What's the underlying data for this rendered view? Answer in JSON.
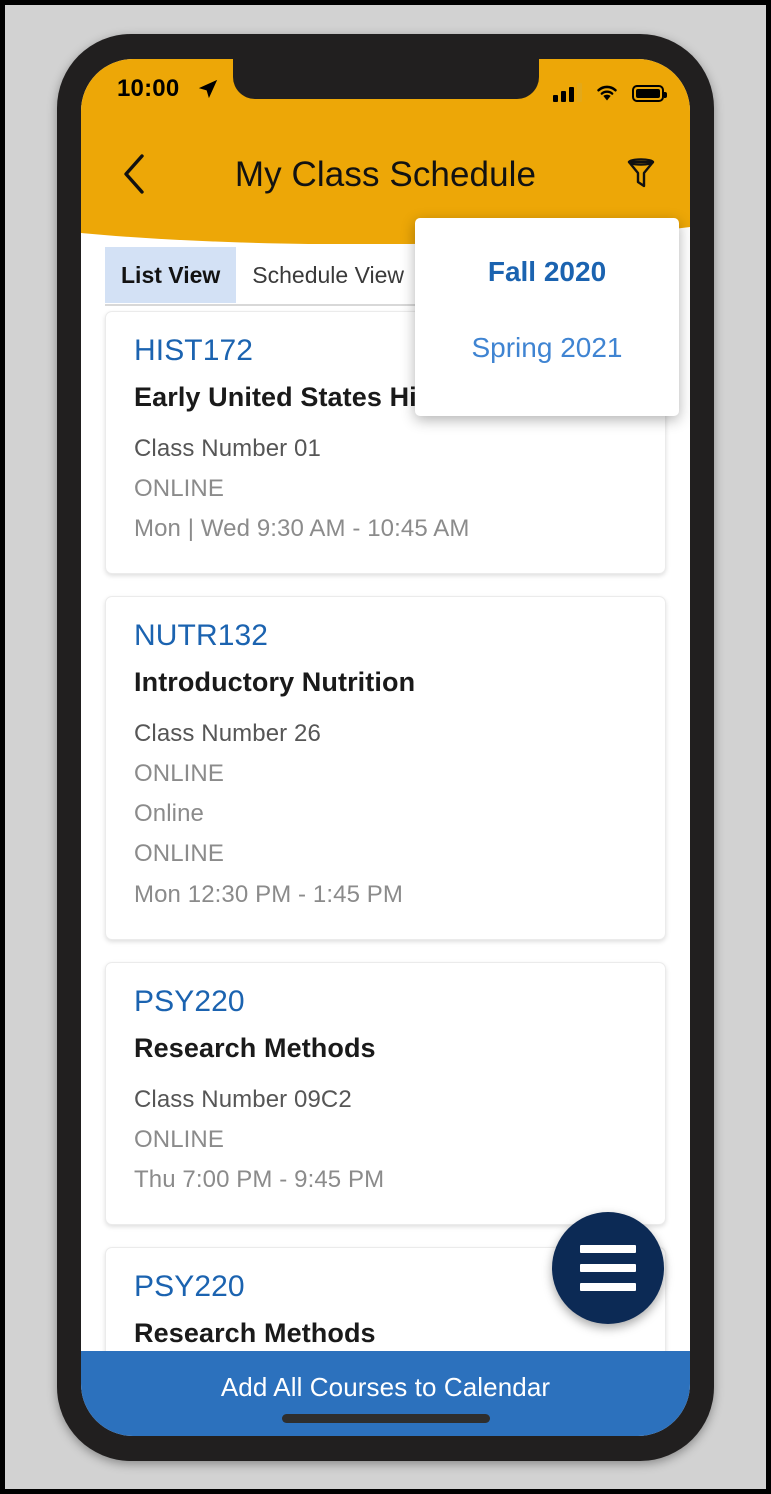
{
  "status_bar": {
    "time": "10:00",
    "location_icon": "location-arrow-icon",
    "signal_icon": "cellular-signal-icon",
    "wifi_icon": "wifi-icon",
    "battery_icon": "battery-full-icon"
  },
  "header": {
    "title": "My Class Schedule",
    "back_icon": "chevron-left-icon",
    "filter_icon": "filter-funnel-icon",
    "background_color": "#eda707"
  },
  "tabs": [
    {
      "label": "List View",
      "active": true
    },
    {
      "label": "Schedule View",
      "active": false
    }
  ],
  "term_menu": {
    "open": true,
    "items": [
      {
        "label": "Fall 2020",
        "selected": true
      },
      {
        "label": "Spring 2021",
        "selected": false
      }
    ]
  },
  "courses": [
    {
      "code": "HIST172",
      "title": "Early United States History",
      "details": [
        {
          "text": "Class Number 01",
          "muted": false
        },
        {
          "text": "ONLINE",
          "muted": true
        },
        {
          "text": "Mon | Wed 9:30 AM - 10:45 AM",
          "muted": true
        }
      ]
    },
    {
      "code": "NUTR132",
      "title": "Introductory Nutrition",
      "details": [
        {
          "text": "Class Number 26",
          "muted": false
        },
        {
          "text": "ONLINE",
          "muted": true
        },
        {
          "text": "Online",
          "muted": true
        },
        {
          "text": "ONLINE",
          "muted": true
        },
        {
          "text": "Mon 12:30 PM - 1:45 PM",
          "muted": true
        }
      ]
    },
    {
      "code": "PSY220",
      "title": "Research Methods",
      "details": [
        {
          "text": "Class Number 09C2",
          "muted": false
        },
        {
          "text": "ONLINE",
          "muted": true
        },
        {
          "text": "Thu 7:00 PM - 9:45 PM",
          "muted": true
        }
      ]
    },
    {
      "code": "PSY220",
      "title": "Research Methods",
      "details": []
    }
  ],
  "fab": {
    "icon": "hamburger-menu-icon",
    "color": "#0c2a55"
  },
  "bottom_action": {
    "label": "Add All Courses to Calendar",
    "color": "#2c71bd"
  },
  "colors": {
    "accent_yellow": "#eda707",
    "link_blue": "#1b63b0",
    "navy": "#0c2a55",
    "button_blue": "#2c71bd"
  }
}
